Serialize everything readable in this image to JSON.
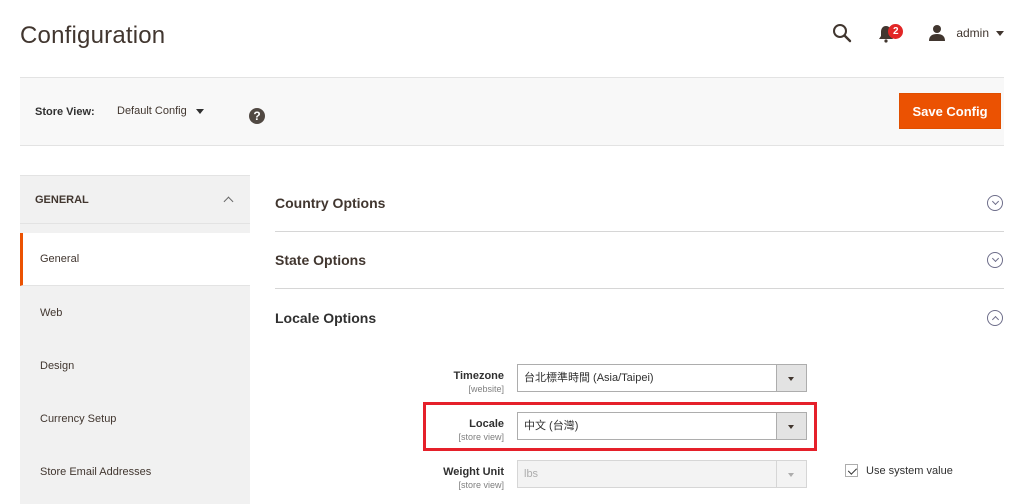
{
  "header": {
    "title": "Configuration",
    "notifications_count": "2",
    "user_name": "admin",
    "icons": {
      "search": "search-icon",
      "notifications": "bell-icon",
      "user": "user-icon"
    }
  },
  "toolbar": {
    "store_view_label": "Store View:",
    "store_view_value": "Default Config",
    "help_glyph": "?",
    "save_label": "Save Config",
    "accent_color": "#eb5202"
  },
  "sidebar": {
    "group_title": "GENERAL",
    "group_expanded": true,
    "items": [
      {
        "label": "General",
        "active": true
      },
      {
        "label": "Web",
        "active": false
      },
      {
        "label": "Design",
        "active": false
      },
      {
        "label": "Currency Setup",
        "active": false
      },
      {
        "label": "Store Email Addresses",
        "active": false
      }
    ]
  },
  "sections": [
    {
      "title": "Country Options",
      "expanded": false
    },
    {
      "title": "State Options",
      "expanded": false
    },
    {
      "title": "Locale Options",
      "expanded": true
    }
  ],
  "locale_fields": [
    {
      "label": "Timezone",
      "scope": "[website]",
      "value": "台北標準時間 (Asia/Taipei)",
      "disabled": false
    },
    {
      "label": "Locale",
      "scope": "[store view]",
      "value": "中文 (台灣)",
      "disabled": false,
      "highlighted": true,
      "highlight_color": "#e5202a"
    },
    {
      "label": "Weight Unit",
      "scope": "[store view]",
      "value": "lbs",
      "disabled": true,
      "use_system_value": true,
      "use_system_label": "Use system value"
    }
  ]
}
